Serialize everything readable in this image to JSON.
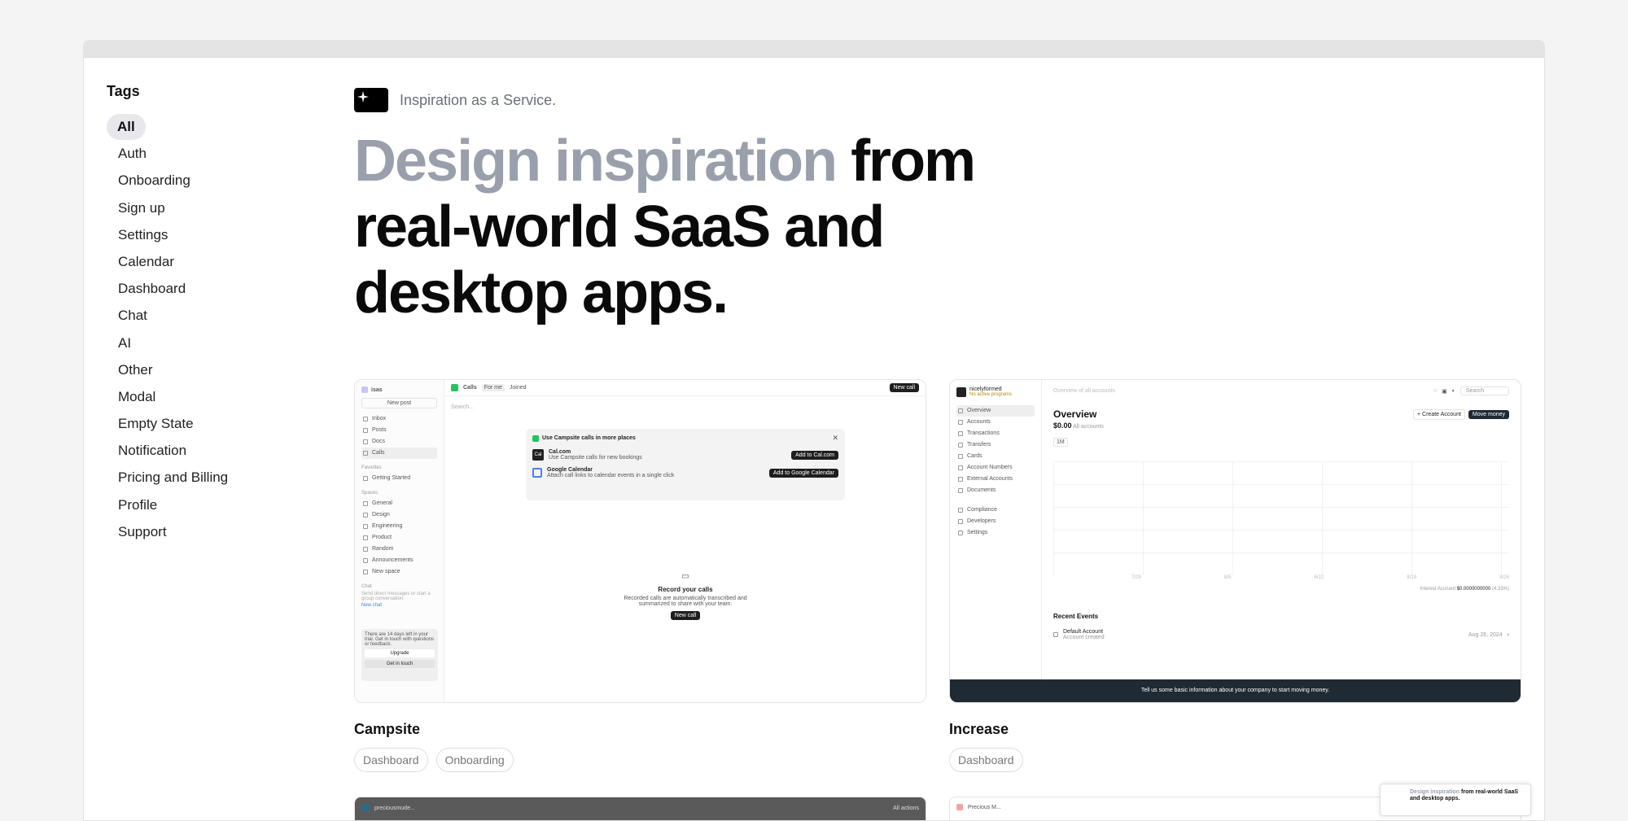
{
  "sidebar": {
    "title": "Tags",
    "tags": [
      "All",
      "Auth",
      "Onboarding",
      "Sign up",
      "Settings",
      "Calendar",
      "Dashboard",
      "Chat",
      "AI",
      "Other",
      "Modal",
      "Empty State",
      "Notification",
      "Pricing and Billing",
      "Profile",
      "Support"
    ],
    "active": "All"
  },
  "hero": {
    "tagline": "Inspiration as a Service.",
    "headline_muted": "Design inspiration",
    "headline_rest": " from real-world SaaS and desktop apps."
  },
  "cards": [
    {
      "title": "Campsite",
      "tags": [
        "Dashboard",
        "Onboarding"
      ],
      "ui": {
        "workspace": "isas",
        "new_post": "New post",
        "nav": [
          "Inbox",
          "Posts",
          "Docs",
          "Calls"
        ],
        "favorites_label": "Favorites",
        "favorite_item": "Getting Started",
        "spaces_label": "Spaces",
        "spaces": [
          "General",
          "Design",
          "Engineering",
          "Product",
          "Random",
          "Announcements",
          "New space"
        ],
        "chat_label": "Chat",
        "chat_hint": "Send direct messages or start a group conversation.",
        "new_chat": "New chat",
        "trial_text": "There are 14 days left in your trial. Get in touch with questions or feedback.",
        "upgrade": "Upgrade",
        "get_in_touch": "Get in touch",
        "page_title": "Calls",
        "filter_a": "For me",
        "filter_b": "Joined",
        "new_call": "New call",
        "search": "Search...",
        "dialog_title": "Use Campsite calls in more places",
        "cal_name": "Cal.com",
        "cal_desc": "Use Campsite calls for new bookings",
        "cal_btn": "Add to Cal.com",
        "gcal_name": "Google Calendar",
        "gcal_desc": "Attach call links to calendar events in a single click",
        "gcal_btn": "Add to Google Calendar",
        "empty_title": "Record your calls",
        "empty_desc": "Recorded calls are automatically transcribed and summarized to share with your team.",
        "empty_btn": "New call"
      }
    },
    {
      "title": "Increase",
      "tags": [
        "Dashboard"
      ],
      "ui": {
        "org": "nicelyformed",
        "org_status": "No active programs",
        "breadcrumb": "Overview of all accounts",
        "search": "Search",
        "nav": [
          "Overview",
          "Accounts",
          "Transactions",
          "Transfers",
          "Cards",
          "Account Numbers",
          "External Accounts",
          "Documents"
        ],
        "nav2": [
          "Compliance",
          "Developers",
          "Settings"
        ],
        "heading": "Overview",
        "balance": "$0.00",
        "balance_label": "All accounts",
        "create_account": "+ Create Account",
        "move_money": "Move money",
        "range": "1M",
        "x_ticks": [
          "7/29",
          "8/5",
          "8/12",
          "8/19",
          "8/26"
        ],
        "interest_label": "Interest Accrued",
        "interest_value": "$0.0000000000",
        "interest_pct": "(4.33%)",
        "recent_events": "Recent Events",
        "event_title": "Default Account",
        "event_sub": "Account created",
        "event_date": "Aug 26, 2024",
        "footer": "Tell us some basic information about your company to start moving money."
      }
    }
  ],
  "bottom": {
    "left_thumb_text": "preciousmude...",
    "left_thumb_right": "All actions",
    "right_thumb_text": "Precious M..."
  },
  "mini_preview": {
    "muted": "Design inspiration",
    "rest": " from real-world SaaS and desktop apps."
  }
}
